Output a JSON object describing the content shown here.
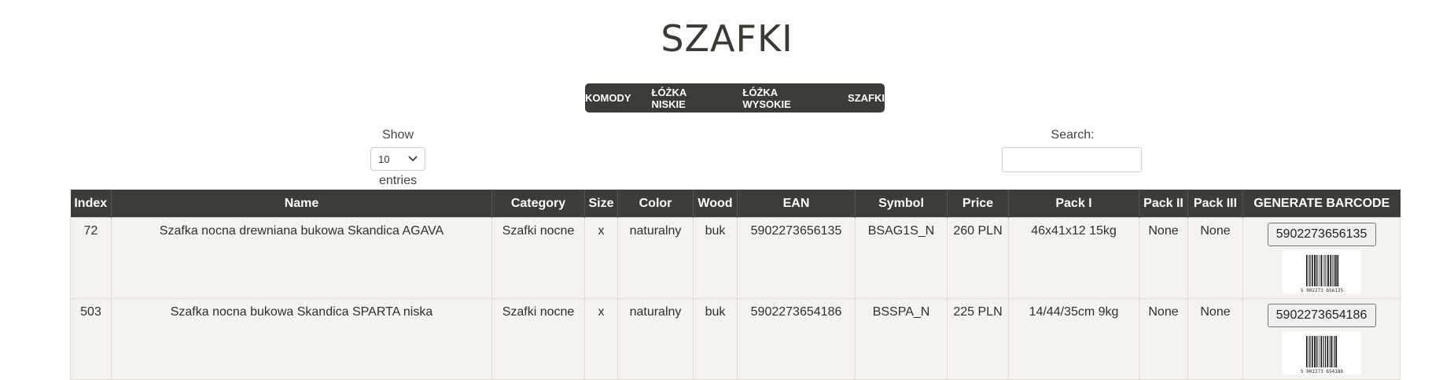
{
  "page": {
    "title": "SZAFKI"
  },
  "nav": {
    "items": [
      "KOMODY",
      "ŁÓŻKA NISKIE",
      "ŁÓŻKA WYSOKIE",
      "SZAFKI"
    ]
  },
  "length": {
    "label_show": "Show",
    "value": "10",
    "label_entries": "entries"
  },
  "search": {
    "label": "Search:",
    "value": ""
  },
  "table": {
    "headers": [
      "Index",
      "Name",
      "Category",
      "Size",
      "Color",
      "Wood",
      "EAN",
      "Symbol",
      "Price",
      "Pack I",
      "Pack II",
      "Pack III",
      "GENERATE BARCODE"
    ],
    "rows": [
      {
        "index": "72",
        "name": "Szafka nocna drewniana bukowa Skandica AGAVA",
        "category": "Szafki nocne",
        "size": "x",
        "color": "naturalny",
        "wood": "buk",
        "ean": "5902273656135",
        "symbol": "BSAG1S_N",
        "price": "260 PLN",
        "pack1": "46x41x12 15kg",
        "pack2": "None",
        "pack3": "None",
        "barcode_button": "5902273656135",
        "barcode_caption": "5 902273 656135"
      },
      {
        "index": "503",
        "name": "Szafka nocna bukowa Skandica SPARTA niska",
        "category": "Szafki nocne",
        "size": "x",
        "color": "naturalny",
        "wood": "buk",
        "ean": "5902273654186",
        "symbol": "BSSPA_N",
        "price": "225 PLN",
        "pack1": "14/44/35cm 9kg",
        "pack2": "None",
        "pack3": "None",
        "barcode_button": "5902273654186",
        "barcode_caption": "5 902273 654186"
      }
    ]
  }
}
